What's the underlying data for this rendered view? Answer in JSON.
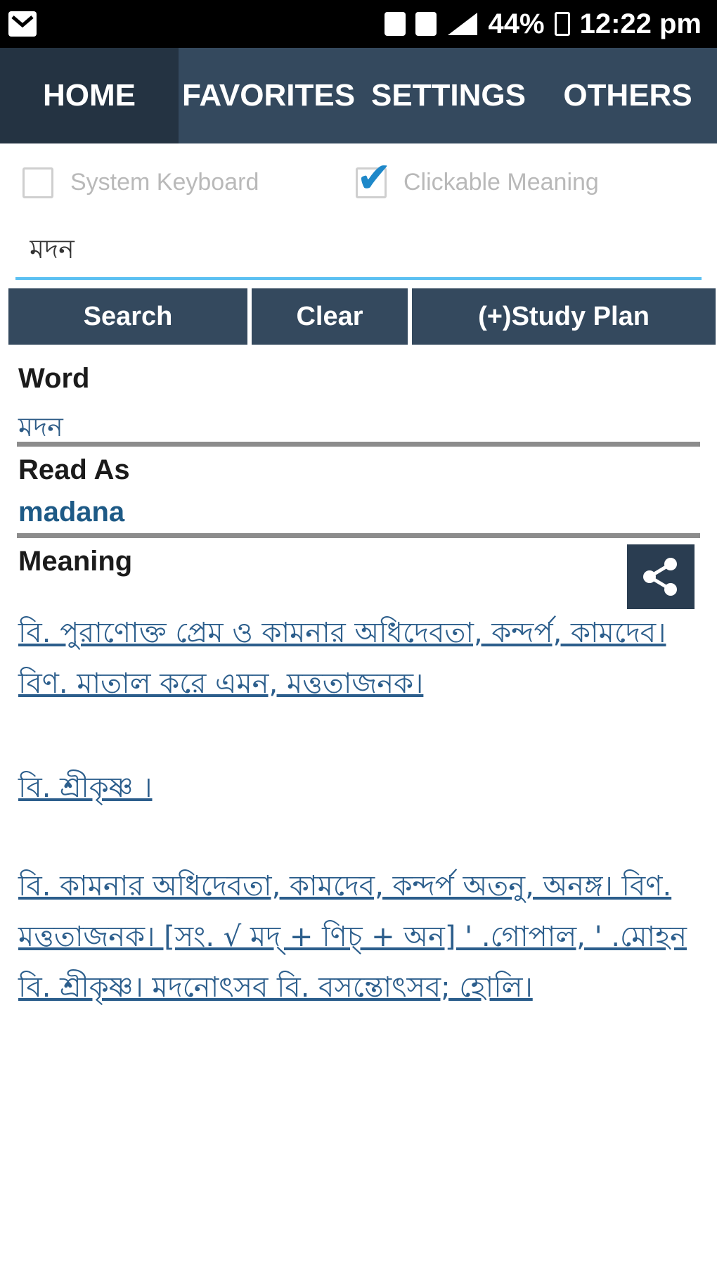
{
  "status_bar": {
    "battery": "44%",
    "time": "12:22 pm",
    "icons": [
      "notification-icon",
      "photo-icon",
      "sim-icon",
      "signal-icon",
      "battery-icon"
    ]
  },
  "tabs": [
    {
      "label": "HOME",
      "active": true
    },
    {
      "label": "FAVORITES",
      "active": false
    },
    {
      "label": "SETTINGS",
      "active": false
    },
    {
      "label": "OTHERS",
      "active": false
    }
  ],
  "options": {
    "system_keyboard": {
      "label": "System Keyboard",
      "checked": false
    },
    "clickable_meaning": {
      "label": "Clickable Meaning",
      "checked": true
    }
  },
  "search": {
    "value": "মদন",
    "placeholder": ""
  },
  "buttons": {
    "search": "Search",
    "clear": "Clear",
    "study_plan": "(+)Study Plan"
  },
  "result": {
    "word_label": "Word",
    "word_value": "মদন",
    "read_as_label": "Read As",
    "read_as_value": "madana",
    "meaning_label": "Meaning",
    "meaning_paragraphs": [
      "বি. পুরাণোক্ত প্রেম ও কামনার অধিদেবতা, কন্দর্প, কামদেব। বিণ. মাতাল করে এমন, মত্ততাজনক।",
      "বি. শ্রীকৃষ্ণ ।",
      "বি. কামনার অধিদেবতা, কামদেব, কন্দর্প অতনু, অনঙ্গ। বিণ. মত্ততাজনক। [সং. √ মদ্ + ণিচ্ + অন] ' .গোপাল, ' .মোহন বি. শ্রীকৃষ্ণ। মদনোৎসব বি. বসন্তোৎসব; হোলি।"
    ]
  },
  "colors": {
    "status_bar": "#000000",
    "tab_bar": "#34495e",
    "tab_active": "#243342",
    "button": "#34495e",
    "accent": "#5bc0f2",
    "checkbox_check": "#1e88c9",
    "link_text": "#2c5e8c"
  }
}
